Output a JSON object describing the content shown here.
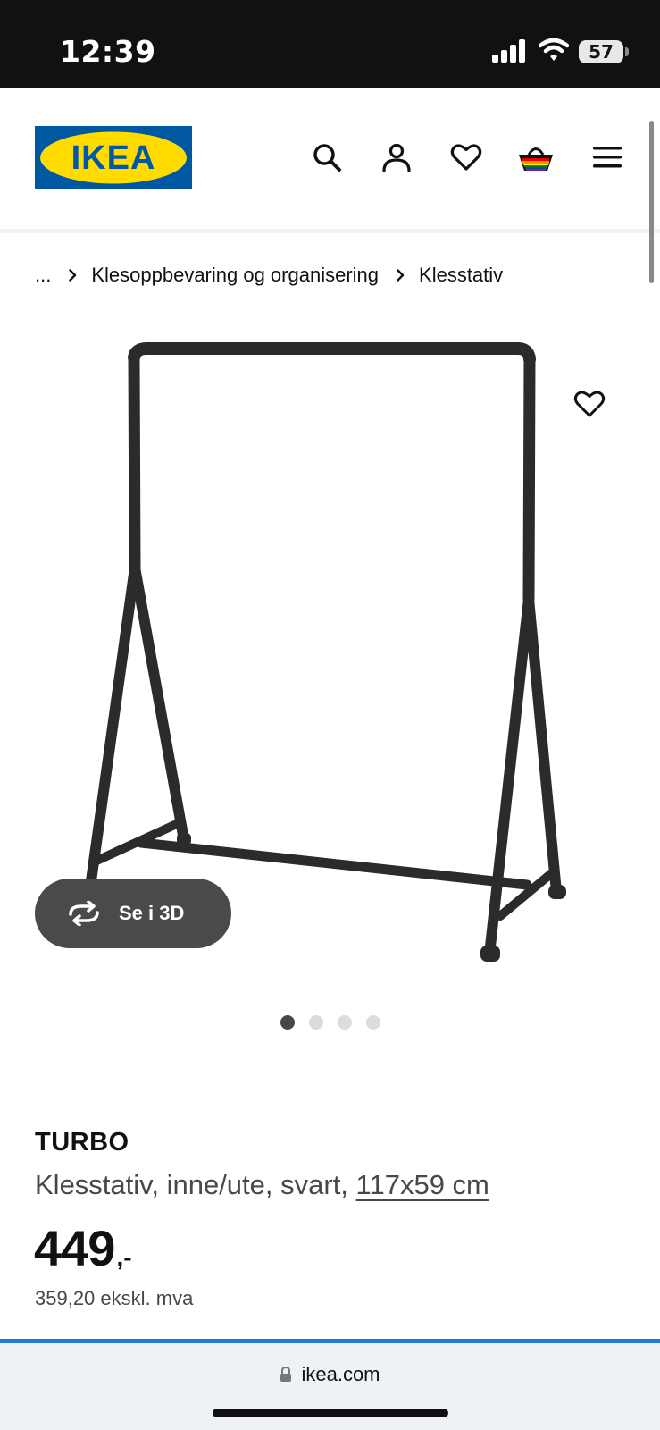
{
  "status_bar": {
    "time": "12:39",
    "battery": "57"
  },
  "header": {
    "logo_text": "IKEA",
    "icons": [
      "search-icon",
      "account-icon",
      "heart-icon",
      "basket-icon",
      "menu-icon"
    ]
  },
  "breadcrumb": {
    "ellipsis": "...",
    "items": [
      "Klesoppbevaring og organisering",
      "Klesstativ"
    ]
  },
  "gallery": {
    "see_3d_label": "Se i 3D",
    "dots": 4,
    "active_dot": 0
  },
  "product": {
    "name": "TURBO",
    "description": "Klesstativ, inne/ute, svart, ",
    "size": "117x59 cm",
    "price": "449",
    "price_suffix": ",-",
    "price_ex_vat": "359,20 ekskl. mva"
  },
  "browser": {
    "url": "ikea.com"
  },
  "colors": {
    "ikea_blue": "#0058A3",
    "ikea_yellow": "#FFDB00",
    "progress_blue": "#1F7AE0",
    "button_dark": "#4A4A4A"
  }
}
